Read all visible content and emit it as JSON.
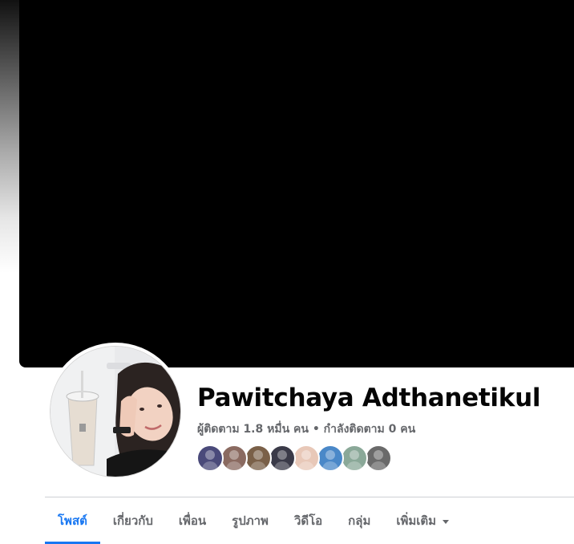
{
  "profile": {
    "name": "Pawitchaya Adthanetikul",
    "follow_stats": "ผู้ติดตาม 1.8 หมื่น คน • กำลังติดตาม 0 คน"
  },
  "friends": [
    {
      "name": "friend-1",
      "color": "#4a4a7a"
    },
    {
      "name": "friend-2",
      "color": "#8a6a60"
    },
    {
      "name": "friend-3",
      "color": "#7a6048"
    },
    {
      "name": "friend-4",
      "color": "#3a3a48"
    },
    {
      "name": "friend-5",
      "color": "#e8c8b8"
    },
    {
      "name": "friend-6",
      "color": "#4a88c8"
    },
    {
      "name": "friend-7",
      "color": "#8aa898"
    },
    {
      "name": "friend-8",
      "color": "#6a6a6a"
    }
  ],
  "tabs": [
    {
      "label": "โพสต์",
      "active": true
    },
    {
      "label": "เกี่ยวกับ",
      "active": false
    },
    {
      "label": "เพื่อน",
      "active": false
    },
    {
      "label": "รูปภาพ",
      "active": false
    },
    {
      "label": "วิดีโอ",
      "active": false
    },
    {
      "label": "กลุ่ม",
      "active": false
    },
    {
      "label": "เพิ่มเติม",
      "active": false
    }
  ],
  "colors": {
    "accent": "#1877f2",
    "secondary_text": "#65676b",
    "cover": "#000000"
  }
}
